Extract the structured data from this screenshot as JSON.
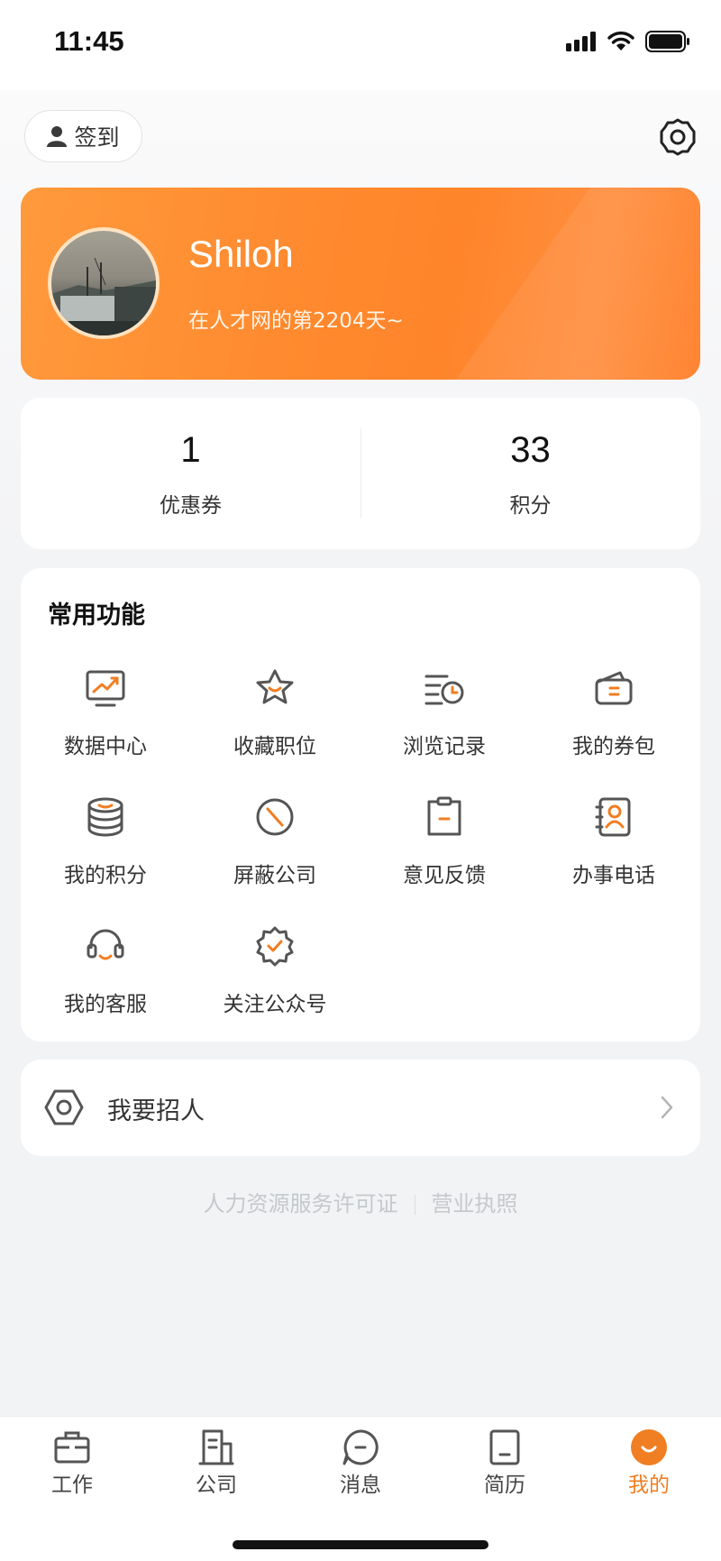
{
  "status_bar": {
    "time": "11:45"
  },
  "header": {
    "signin_label": "签到"
  },
  "profile": {
    "name": "Shiloh",
    "days_text": "在人才网的第2204天~"
  },
  "stats": [
    {
      "value": "1",
      "label": "优惠券"
    },
    {
      "value": "33",
      "label": "积分"
    }
  ],
  "features": {
    "title": "常用功能",
    "items": [
      {
        "label": "数据中心",
        "icon": "chart-icon"
      },
      {
        "label": "收藏职位",
        "icon": "star-icon"
      },
      {
        "label": "浏览记录",
        "icon": "history-icon"
      },
      {
        "label": "我的券包",
        "icon": "wallet-icon"
      },
      {
        "label": "我的积分",
        "icon": "coins-icon"
      },
      {
        "label": "屏蔽公司",
        "icon": "block-icon"
      },
      {
        "label": "意见反馈",
        "icon": "feedback-icon"
      },
      {
        "label": "办事电话",
        "icon": "contacts-icon"
      },
      {
        "label": "我的客服",
        "icon": "headset-icon"
      },
      {
        "label": "关注公众号",
        "icon": "badge-check-icon"
      }
    ]
  },
  "recruit": {
    "label": "我要招人"
  },
  "footer": {
    "license": "人力资源服务许可证",
    "business": "营业执照"
  },
  "tabbar": {
    "items": [
      {
        "label": "工作",
        "icon": "briefcase-icon"
      },
      {
        "label": "公司",
        "icon": "building-icon"
      },
      {
        "label": "消息",
        "icon": "message-icon"
      },
      {
        "label": "简历",
        "icon": "resume-icon"
      },
      {
        "label": "我的",
        "icon": "profile-icon"
      }
    ],
    "active": "我的"
  },
  "colors": {
    "accent": "#f07e22",
    "banner_start": "#ff9a3c",
    "banner_end": "#ff7b22",
    "icon_stroke": "#555555"
  }
}
